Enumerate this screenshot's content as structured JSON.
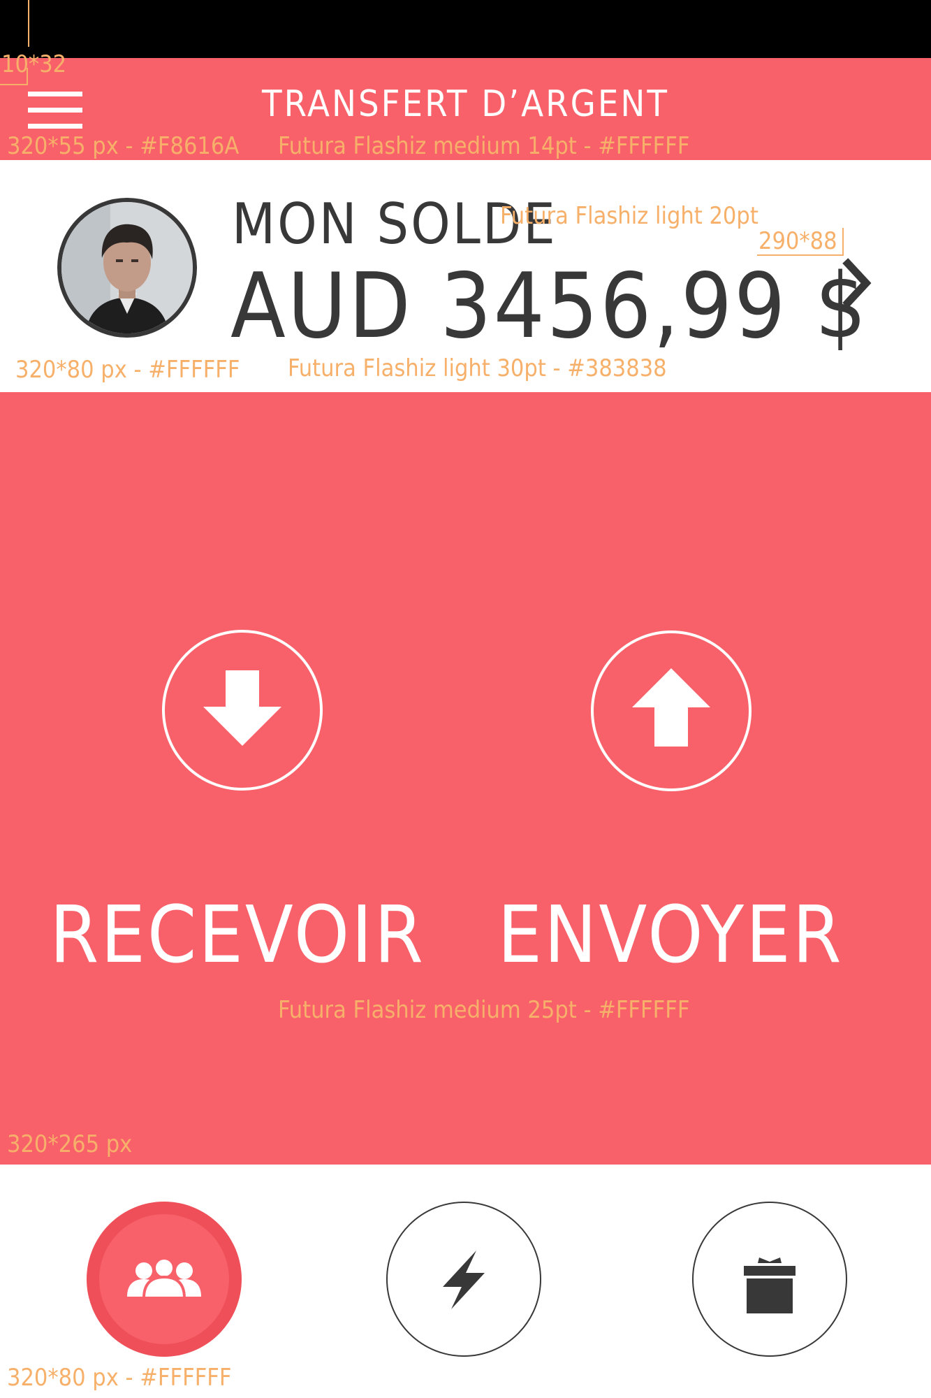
{
  "header": {
    "title": "TRANSFERT D’ARGENT",
    "menu_icon": "menu-icon"
  },
  "balance": {
    "label": "MON SOLDE",
    "amount": "AUD 3456,99 $",
    "avatar_icon": "avatar-photo",
    "chevron_icon": "chevron-right-icon"
  },
  "actions": {
    "receive": {
      "label": "RECEVOIR",
      "icon": "arrow-down-icon"
    },
    "send": {
      "label": "ENVOYER",
      "icon": "arrow-up-icon"
    }
  },
  "tabbar": {
    "tabs": [
      {
        "icon": "people-icon",
        "active": true
      },
      {
        "icon": "lightning-icon",
        "active": false
      },
      {
        "icon": "gift-icon",
        "active": false
      }
    ]
  },
  "annotations": {
    "status_spec": "10*32",
    "header_size": "320*55 px - #F8616A",
    "header_font": "Futura Flashiz medium 14pt - #FFFFFF",
    "label_font": "Futura Flashiz light 20pt",
    "balance_touch": "290*88",
    "balance_size": "320*80 px - #FFFFFF",
    "balance_font": "Futura Flashiz light 30pt - #383838",
    "action_font": "Futura Flashiz medium 25pt - #FFFFFF",
    "actions_size": "320*265 px",
    "tabbar_size": "320*80 px - #FFFFFF"
  },
  "colors": {
    "accent": "#F8616A",
    "text_dark": "#383838",
    "white": "#FFFFFF",
    "spec": "#F7B06A"
  }
}
